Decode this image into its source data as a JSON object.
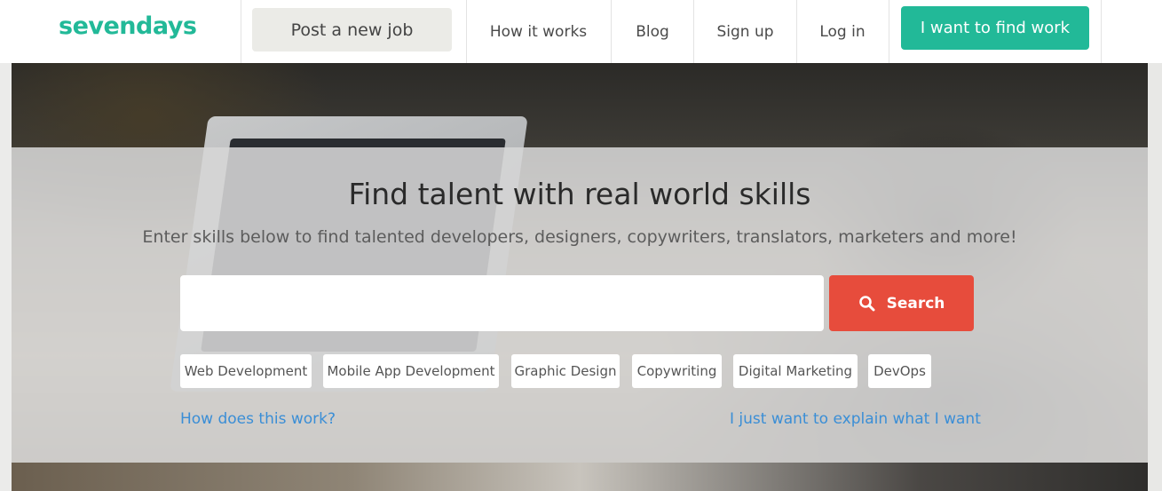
{
  "header": {
    "logo": "sevendays",
    "post_job_label": "Post a new job",
    "nav": [
      {
        "label": "How it works"
      },
      {
        "label": "Blog"
      },
      {
        "label": "Sign up"
      },
      {
        "label": "Log in"
      }
    ],
    "find_work_label": "I want to find work"
  },
  "hero": {
    "title": "Find talent with real world skills",
    "subtitle": "Enter skills below to find talented developers, designers, copywriters, translators, marketers and more!",
    "search": {
      "placeholder": "",
      "value": "",
      "button_label": "Search",
      "button_icon": "search-icon"
    },
    "tags": [
      {
        "label": "Web Development"
      },
      {
        "label": "Mobile App Development"
      },
      {
        "label": "Graphic Design"
      },
      {
        "label": "Copywriting"
      },
      {
        "label": "Digital Marketing"
      },
      {
        "label": "DevOps"
      }
    ],
    "links": {
      "how_it_works": "How does this work?",
      "explain": "I just want to explain what I want"
    }
  },
  "colors": {
    "brand": "#22b998",
    "search_button": "#e74c3c",
    "link": "#3a8ed6"
  }
}
